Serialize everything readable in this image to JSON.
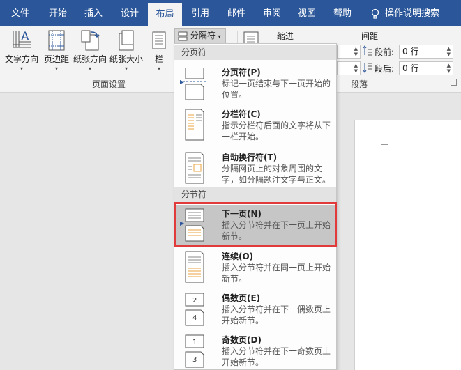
{
  "tabs": [
    {
      "label": "文件"
    },
    {
      "label": "开始"
    },
    {
      "label": "插入"
    },
    {
      "label": "设计"
    },
    {
      "label": "布局"
    },
    {
      "label": "引用"
    },
    {
      "label": "邮件"
    },
    {
      "label": "审阅"
    },
    {
      "label": "视图"
    },
    {
      "label": "帮助"
    }
  ],
  "tell_me": "操作说明搜索",
  "ribbon": {
    "page_setup": {
      "buttons": [
        {
          "label": "文字方向"
        },
        {
          "label": "页边距"
        },
        {
          "label": "纸张方向"
        },
        {
          "label": "纸张大小"
        },
        {
          "label": "栏"
        }
      ],
      "group_label": "页面设置"
    },
    "breaks_label": "分隔符",
    "paragraph": {
      "indent_label": "缩进",
      "spacing_label": "间距",
      "before_label": "段前:",
      "before_value": "0 行",
      "after_label": "段后:",
      "after_value": "0 行",
      "group_label": "段落"
    }
  },
  "dropdown": {
    "page_breaks_header": "分页符",
    "section_breaks_header": "分节符",
    "items": [
      {
        "title": "分页符(P)",
        "desc": "标记一页结束与下一页开始的位置。"
      },
      {
        "title": "分栏符(C)",
        "desc": "指示分栏符后面的文字将从下一栏开始。"
      },
      {
        "title": "自动换行符(T)",
        "desc": "分隔网页上的对象周围的文字，如分隔题注文字与正文。"
      },
      {
        "title": "下一页(N)",
        "desc": "插入分节符并在下一页上开始新节。"
      },
      {
        "title": "连续(O)",
        "desc": "插入分节符并在同一页上开始新节。"
      },
      {
        "title": "偶数页(E)",
        "desc": "插入分节符并在下一偶数页上开始新节。"
      },
      {
        "title": "奇数页(D)",
        "desc": "插入分节符并在下一奇数页上开始新节。"
      }
    ]
  },
  "colors": {
    "tab_bar": "#2b579a",
    "highlight": "#e03a3a",
    "icon_accent": "#e8a33c"
  }
}
